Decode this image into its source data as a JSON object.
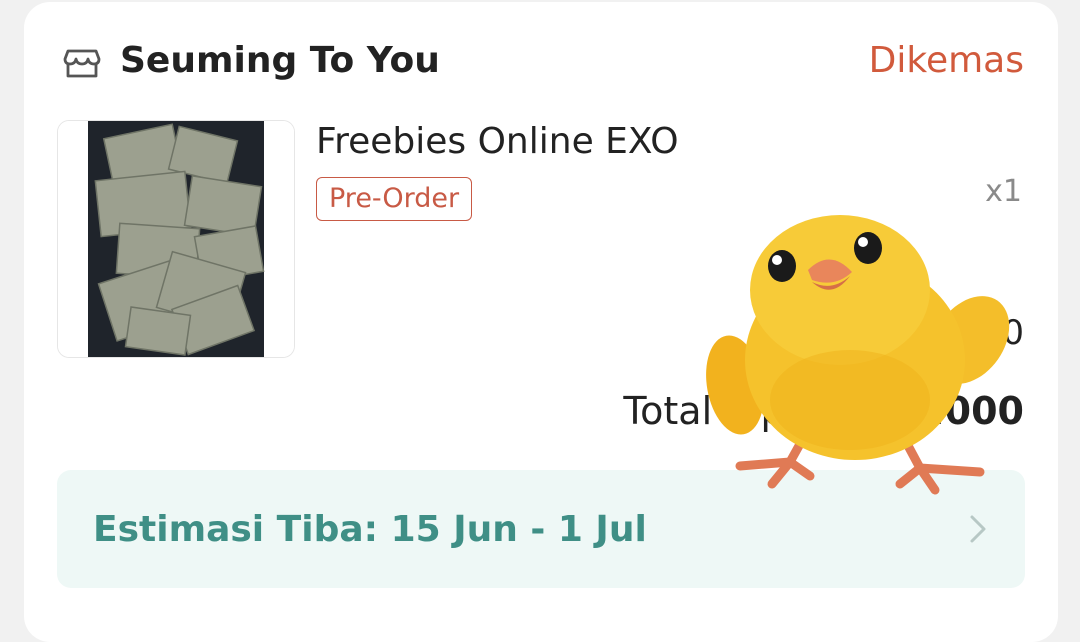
{
  "shop": {
    "icon": "store-icon",
    "name": "Seuming To You",
    "status": "Dikemas"
  },
  "product": {
    "title": "Freebies Online EXO",
    "badge": "Pre-Order",
    "quantity": "x1",
    "price_partial": "00",
    "total_label": "Total 1 pr",
    "total_amount": ".000"
  },
  "delivery": {
    "text": "Estimasi Tiba: 15 Jun - 1 Jul",
    "icon": "chevron-right-icon"
  },
  "colors": {
    "accent": "#d15a3c",
    "delivery_text": "#3f8f86",
    "delivery_bg": "#eef8f6"
  }
}
